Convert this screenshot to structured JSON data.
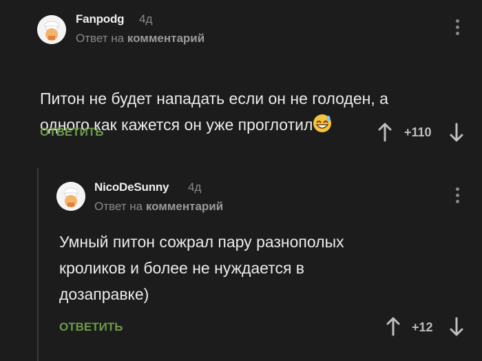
{
  "comments": [
    {
      "author": "Fanpodg",
      "time": "4д",
      "reply_prefix": "Ответ на",
      "reply_link": "комментарий",
      "text": "Питон не будет нападать если он не голоден, а\nодного как кажется он уже проглотил",
      "reply_button": "ОТВЕТИТЬ",
      "rating": "+110",
      "emoji_icon": "grinning-sweat-emoji"
    },
    {
      "author": "NicoDeSunny",
      "time": "4д",
      "reply_prefix": "Ответ на",
      "reply_link": "комментарий",
      "text": "Умный питон сожрал пару разнополых\nкроликов и более не нуждается в\nдозаправке)",
      "reply_button": "ОТВЕТИТЬ",
      "rating": "+12"
    }
  ],
  "colors": {
    "background": "#1c1c1c",
    "accent_green": "#6c9b4a",
    "muted": "#8a8a8a"
  }
}
